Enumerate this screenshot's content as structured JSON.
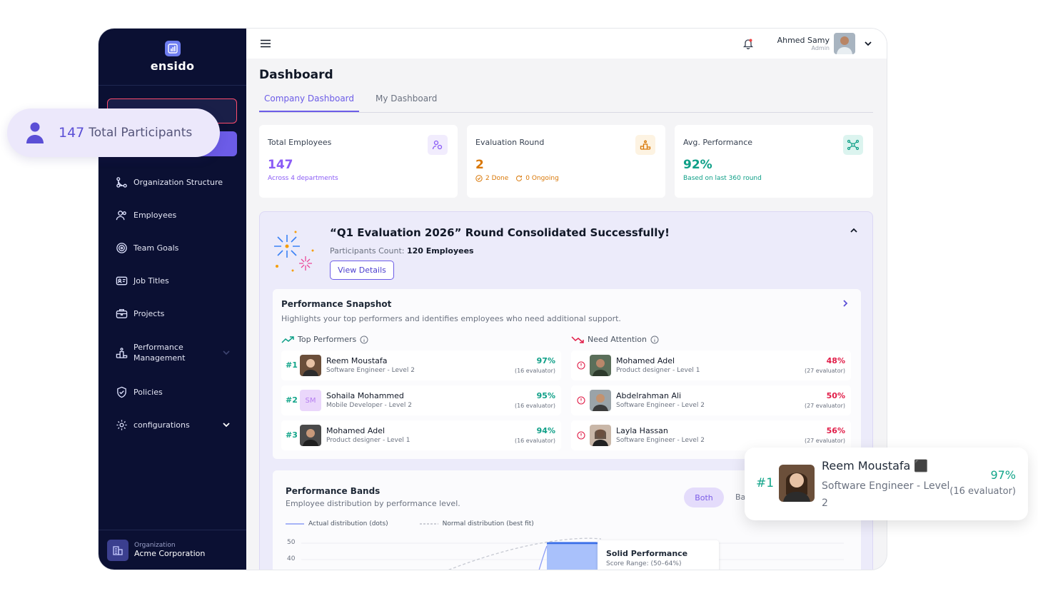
{
  "app": {
    "name": "ensido"
  },
  "sidebar": {
    "items": [
      {
        "label": "Organization Structure",
        "icon": "org-structure-icon"
      },
      {
        "label": "Employees",
        "icon": "employees-icon"
      },
      {
        "label": "Team Goals",
        "icon": "target-icon"
      },
      {
        "label": "Job Titles",
        "icon": "id-card-icon"
      },
      {
        "label": "Projects",
        "icon": "briefcase-icon"
      },
      {
        "label": "Performance Management",
        "icon": "podium-icon"
      },
      {
        "label": "Policies",
        "icon": "shield-icon"
      },
      {
        "label": "configurations",
        "icon": "gear-icon"
      }
    ],
    "org_label": "Organization",
    "org_name": "Acme Corporation"
  },
  "header": {
    "user_name": "Ahmed Samy",
    "user_role": "Admin"
  },
  "page": {
    "title": "Dashboard"
  },
  "tabs": [
    {
      "label": "Company Dashboard",
      "active": true
    },
    {
      "label": "My Dashboard",
      "active": false
    }
  ],
  "stats": [
    {
      "title": "Total Employees",
      "value": "147",
      "sub": "Across 4 departments",
      "color": "#8b5cf6"
    },
    {
      "title": "Evaluation Round",
      "value": "2",
      "sub_done": "2 Done",
      "sub_ongoing": "0 Ongoing",
      "color": "#d97706"
    },
    {
      "title": "Avg. Performance",
      "value": "92%",
      "sub": "Based on last 360 round",
      "color": "#0e9f87"
    }
  ],
  "banner": {
    "title": "“Q1 Evaluation 2026” Round Consolidated Successfully!",
    "participants_label": "Participants Count:",
    "participants_value": "120 Employees",
    "view_label": "View Details"
  },
  "snapshot": {
    "title": "Performance Snapshot",
    "subtitle": "Highlights your top performers and identifies employees who need additional support.",
    "top_label": "Top Performers",
    "attention_label": "Need Attention",
    "top": [
      {
        "rank": "#1",
        "name": "Reem Moustafa",
        "role": "Software Engineer - Level 2",
        "score": "97%",
        "evaluators": "(16 evaluator)"
      },
      {
        "rank": "#2",
        "name": "Sohaila Mohammed",
        "role": "Mobile Developer - Level 2",
        "score": "95%",
        "evaluators": "(16 evaluator)",
        "initials": "SM"
      },
      {
        "rank": "#3",
        "name": "Mohamed Adel",
        "role": "Product designer - Level 1",
        "score": "94%",
        "evaluators": "(16 evaluator)"
      }
    ],
    "attention": [
      {
        "name": "Mohamed Adel",
        "role": "Product designer - Level 1",
        "score": "48%",
        "evaluators": "(27 evaluator)"
      },
      {
        "name": "Abdelrahman Ali",
        "role": "Software Engineer - Level 2",
        "score": "50%",
        "evaluators": "(27 evaluator)"
      },
      {
        "name": "Layla Hassan",
        "role": "Software Engineer - Level 2",
        "score": "56%",
        "evaluators": "(27 evaluator)"
      }
    ]
  },
  "bands": {
    "title": "Performance Bands",
    "subtitle": "Employee distribution by performance level.",
    "toggle_both": "Both",
    "toggle_ba": "Ba",
    "legend_actual": "Actual distribution (dots)",
    "legend_normal": "Normal distribution (best fit)",
    "ticks": [
      "50",
      "40"
    ],
    "tooltip_title": "Solid Performance",
    "tooltip_sub": "Score Range: (50–64%)"
  },
  "pill": {
    "count": "147",
    "label": "Total Participants"
  },
  "float_card": {
    "rank": "#1",
    "name": "Reem Moustafa ⬛",
    "role": "Software Engineer - Level 2",
    "score": "97%",
    "evaluators": "(16 evaluator)"
  }
}
